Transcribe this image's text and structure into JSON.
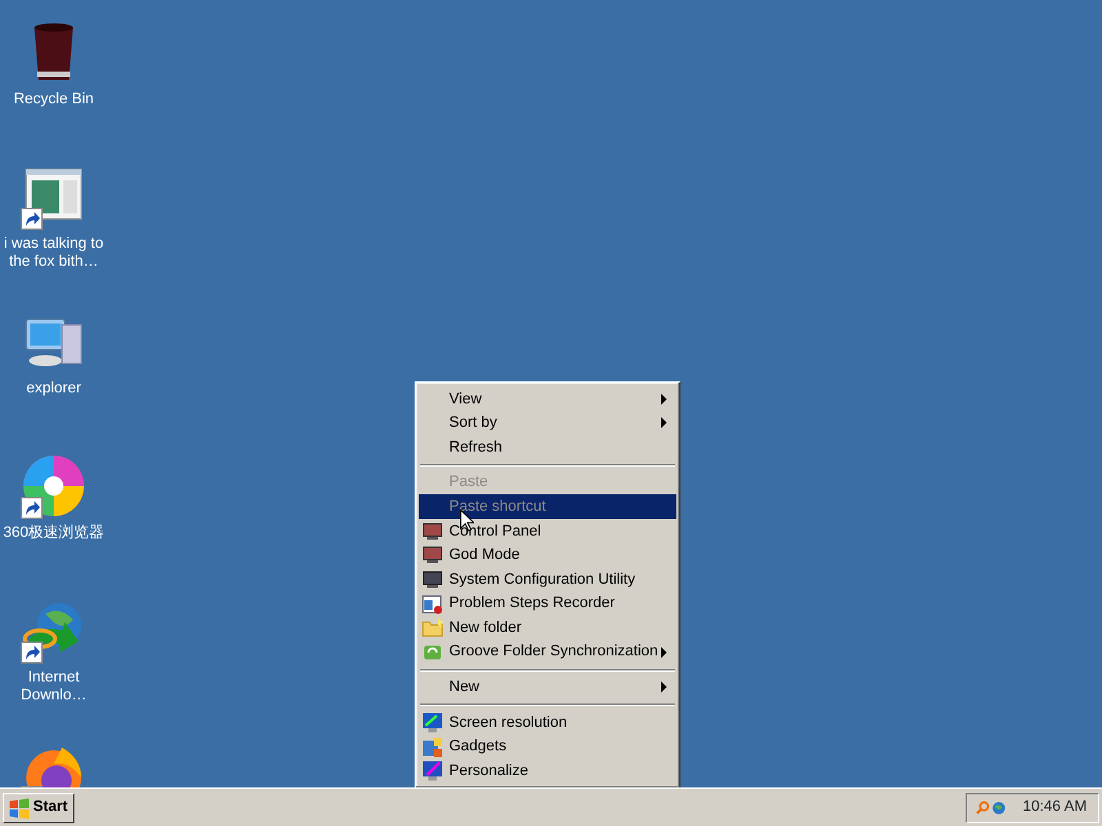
{
  "desktop_icons": [
    {
      "label": "Recycle Bin",
      "shortcut": false
    },
    {
      "label": "i was talking to the fox bith…",
      "shortcut": true
    },
    {
      "label": "explorer",
      "shortcut": false
    },
    {
      "label": "360极速浏览器",
      "shortcut": true
    },
    {
      "label": "Internet Downlo…",
      "shortcut": true
    },
    {
      "shortcut": true
    }
  ],
  "context_menu": {
    "items": [
      {
        "kind": "item",
        "label": "View",
        "submenu": true,
        "disabled": false,
        "selected": false
      },
      {
        "kind": "item",
        "label": "Sort by",
        "submenu": true,
        "disabled": false,
        "selected": false
      },
      {
        "kind": "item",
        "label": "Refresh",
        "submenu": false,
        "disabled": false,
        "selected": false
      },
      {
        "kind": "separator"
      },
      {
        "kind": "item",
        "label": "Paste",
        "submenu": false,
        "disabled": true,
        "selected": false
      },
      {
        "kind": "item",
        "label": "Paste shortcut",
        "submenu": false,
        "disabled": true,
        "selected": true
      },
      {
        "kind": "item",
        "label": "Control Panel",
        "submenu": false,
        "disabled": false,
        "selected": false
      },
      {
        "kind": "item",
        "label": "God Mode",
        "submenu": false,
        "disabled": false,
        "selected": false
      },
      {
        "kind": "item",
        "label": "System Configuration Utility",
        "submenu": false,
        "disabled": false,
        "selected": false
      },
      {
        "kind": "item",
        "label": "Problem Steps Recorder",
        "submenu": false,
        "disabled": false,
        "selected": false
      },
      {
        "kind": "item",
        "label": "New folder",
        "submenu": false,
        "disabled": false,
        "selected": false
      },
      {
        "kind": "item",
        "label": "Groove Folder Synchronization",
        "submenu": true,
        "disabled": false,
        "selected": false
      },
      {
        "kind": "separator"
      },
      {
        "kind": "item",
        "label": "New",
        "submenu": true,
        "disabled": false,
        "selected": false
      },
      {
        "kind": "separator"
      },
      {
        "kind": "item",
        "label": "Screen resolution",
        "submenu": false,
        "disabled": false,
        "selected": false
      },
      {
        "kind": "item",
        "label": "Gadgets",
        "submenu": false,
        "disabled": false,
        "selected": false
      },
      {
        "kind": "item",
        "label": "Personalize",
        "submenu": false,
        "disabled": false,
        "selected": false
      }
    ]
  },
  "taskbar": {
    "start_label": "Start",
    "clock": "10:46 AM"
  }
}
